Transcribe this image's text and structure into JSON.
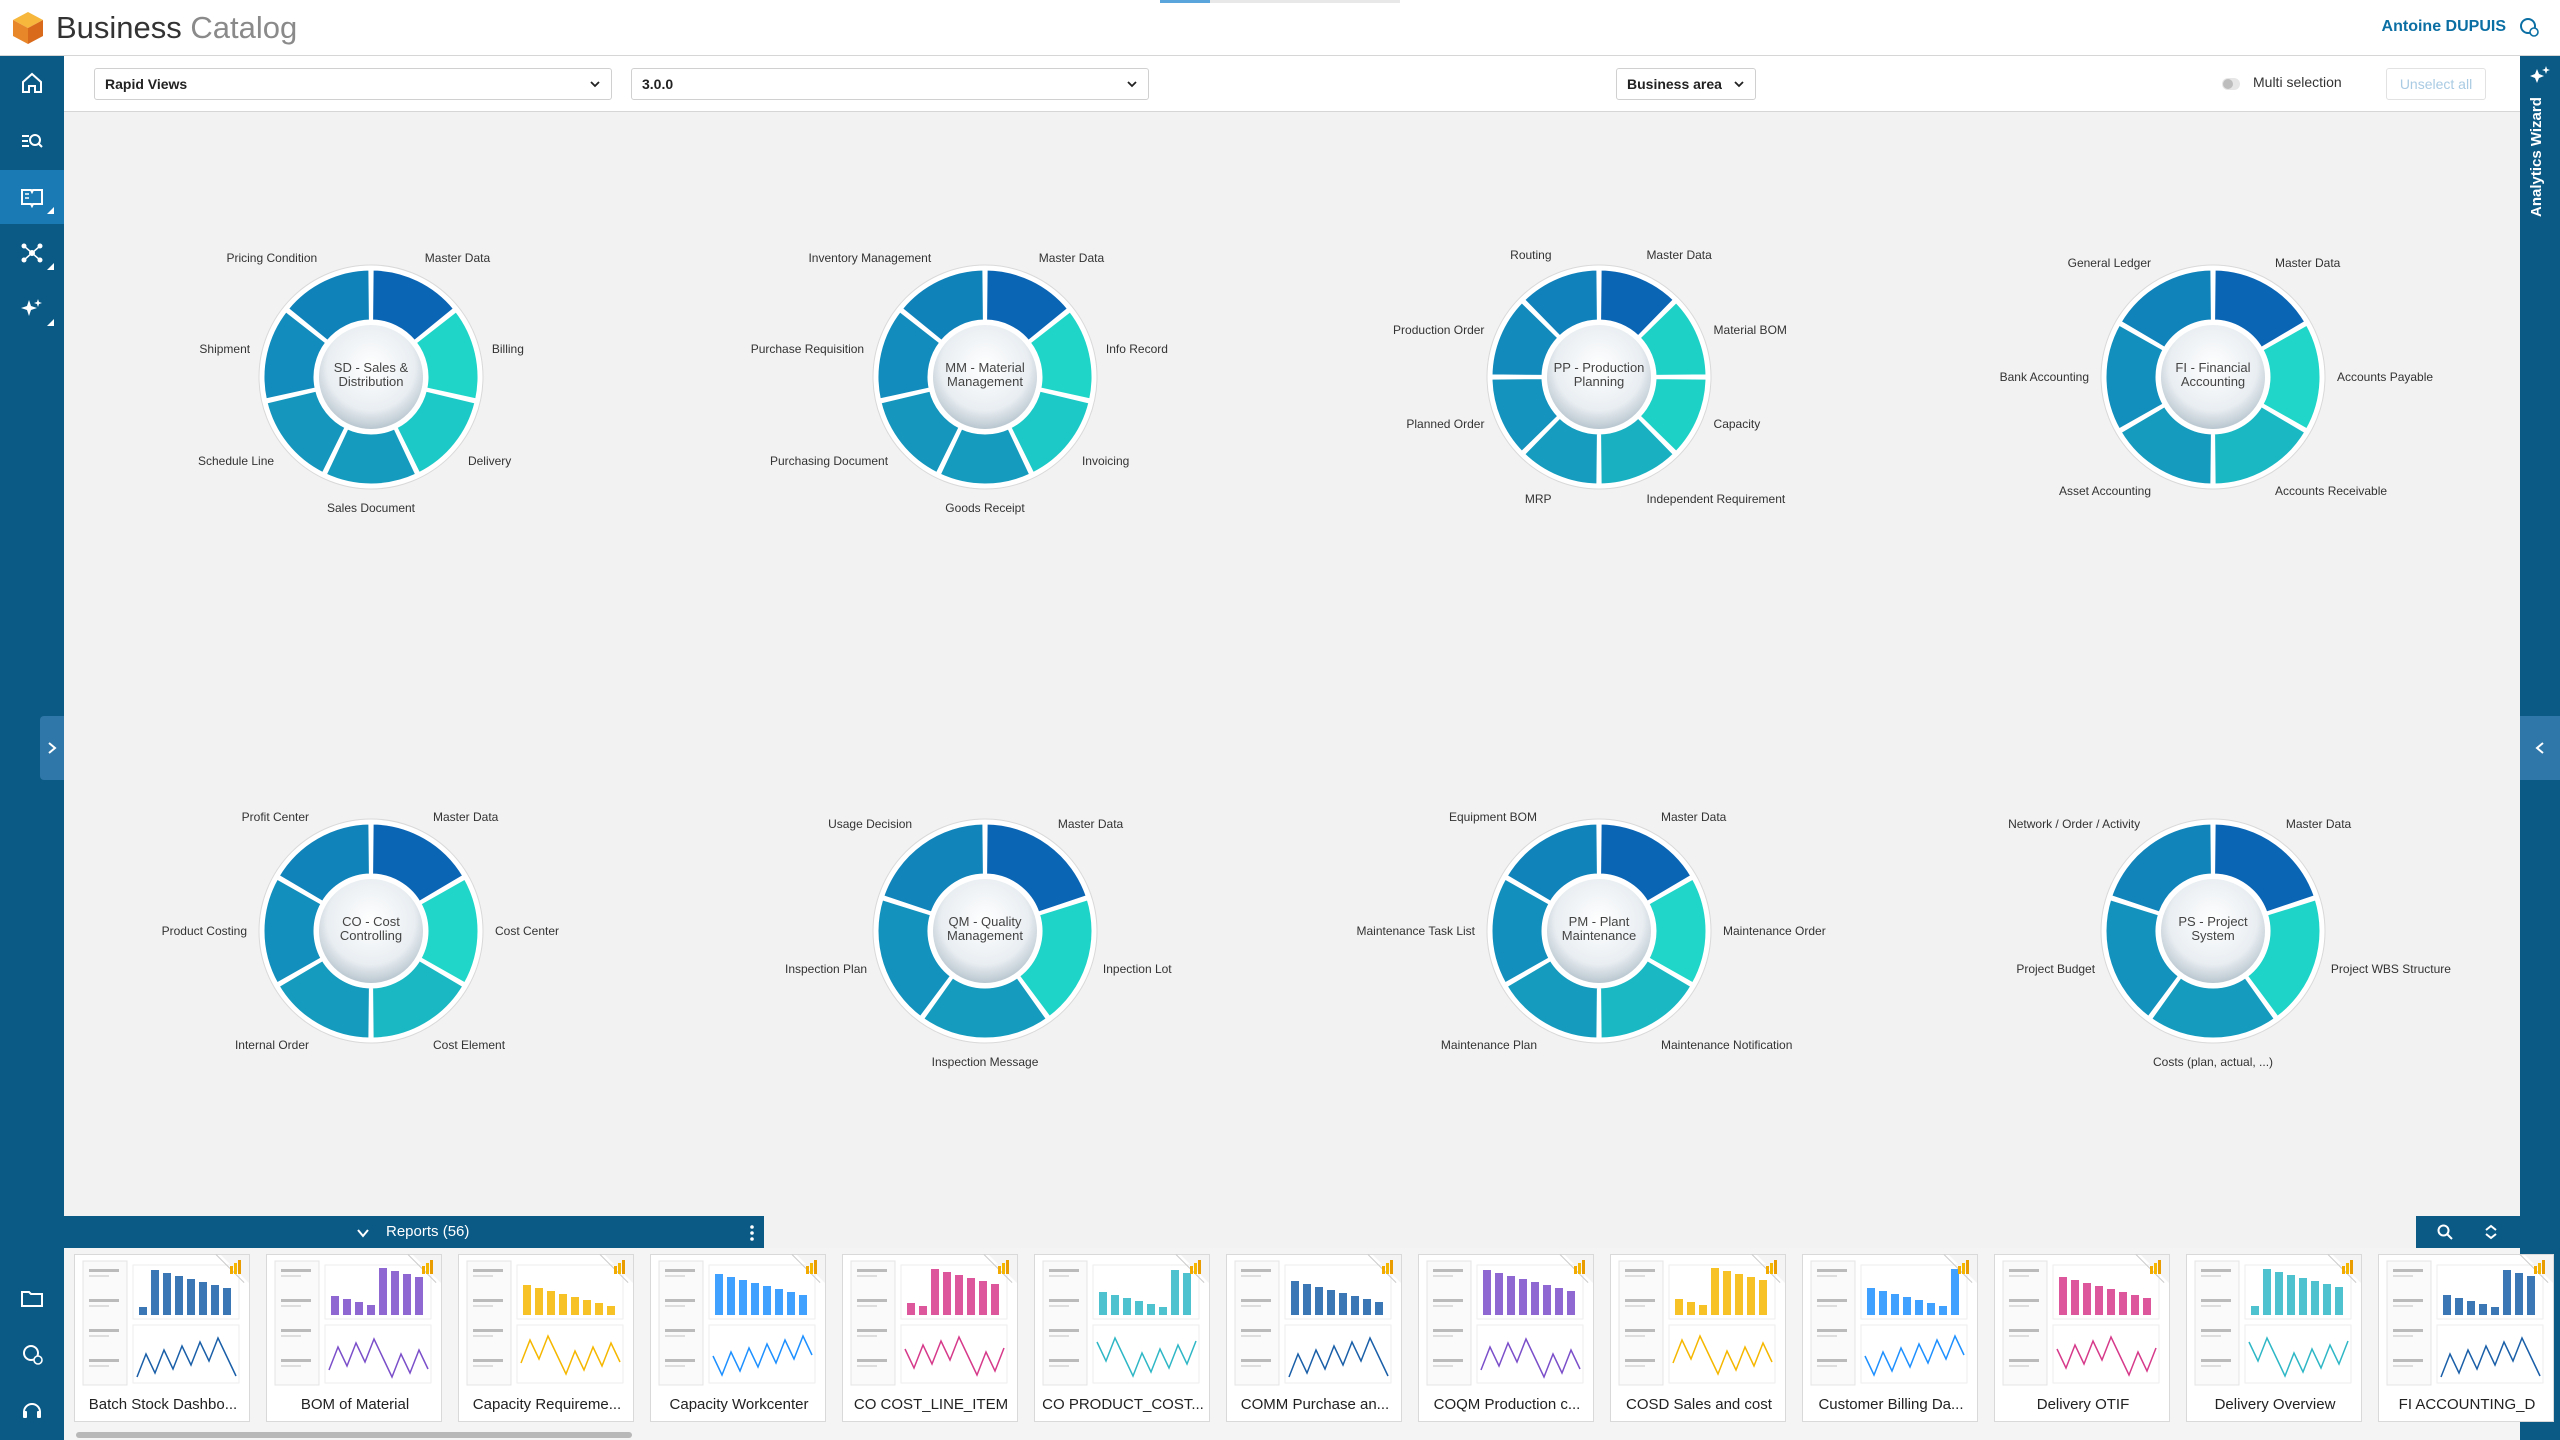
{
  "header": {
    "title_main": "Business",
    "title_sub": "Catalog",
    "user_name": "Antoine DUPUIS"
  },
  "toolbar": {
    "view_select": "Rapid Views",
    "version_select": "3.0.0",
    "area_select": "Business area",
    "multi_selection_label": "Multi selection",
    "unselect_all_label": "Unselect all"
  },
  "right_panel": {
    "label": "Analytics Wizard"
  },
  "colors": {
    "sidebar": "#0b5a86",
    "accent": "#1a7ab4",
    "wheel_dark": "#0a5fb4",
    "wheel_light": "#1fd6c8"
  },
  "wheels": [
    {
      "center": "SD - Sales & Distribution",
      "segments": [
        "Master Data",
        "Billing",
        "Delivery",
        "Sales Document",
        "Schedule Line",
        "Shipment",
        "Pricing Condition"
      ]
    },
    {
      "center": "MM - Material Management",
      "segments": [
        "Master Data",
        "Info Record",
        "Invoicing",
        "Goods Receipt",
        "Purchasing Document",
        "Purchase Requisition",
        "Inventory Management"
      ]
    },
    {
      "center": "PP - Production Planning",
      "segments": [
        "Master Data",
        "Material BOM",
        "Capacity",
        "Independent Requirement",
        "MRP",
        "Planned Order",
        "Production Order",
        "Routing"
      ]
    },
    {
      "center": "FI - Financial Accounting",
      "segments": [
        "Master Data",
        "Accounts Payable",
        "Accounts Receivable",
        "Asset Accounting",
        "Bank Accounting",
        "General Ledger"
      ]
    },
    {
      "center": "CO - Cost Controlling",
      "segments": [
        "Master Data",
        "Cost Center",
        "Cost Element",
        "Internal Order",
        "Product Costing",
        "Profit Center"
      ]
    },
    {
      "center": "QM - Quality Management",
      "segments": [
        "Master Data",
        "Inpection Lot",
        "Inspection Message",
        "Inspection Plan",
        "Usage Decision"
      ]
    },
    {
      "center": "PM - Plant Maintenance",
      "segments": [
        "Master Data",
        "Maintenance Order",
        "Maintenance Notification",
        "Maintenance Plan",
        "Maintenance Task List",
        "Equipment BOM"
      ]
    },
    {
      "center": "PS - Project System",
      "segments": [
        "Master Data",
        "Project WBS Structure",
        "Costs (plan, actual, ...)",
        "Project Budget",
        "Network / Order / Activity"
      ]
    }
  ],
  "reports": {
    "title": "Reports",
    "count": "(56)",
    "items": [
      "Batch Stock Dashbo...",
      "BOM of Material",
      "Capacity Requireme...",
      "Capacity Workcenter",
      "CO COST_LINE_ITEM",
      "CO PRODUCT_COST...",
      "COMM Purchase an...",
      "COQM Production c...",
      "COSD Sales and cost",
      "Customer Billing Da...",
      "Delivery OTIF",
      "Delivery Overview",
      "FI ACCOUNTING_D"
    ]
  }
}
